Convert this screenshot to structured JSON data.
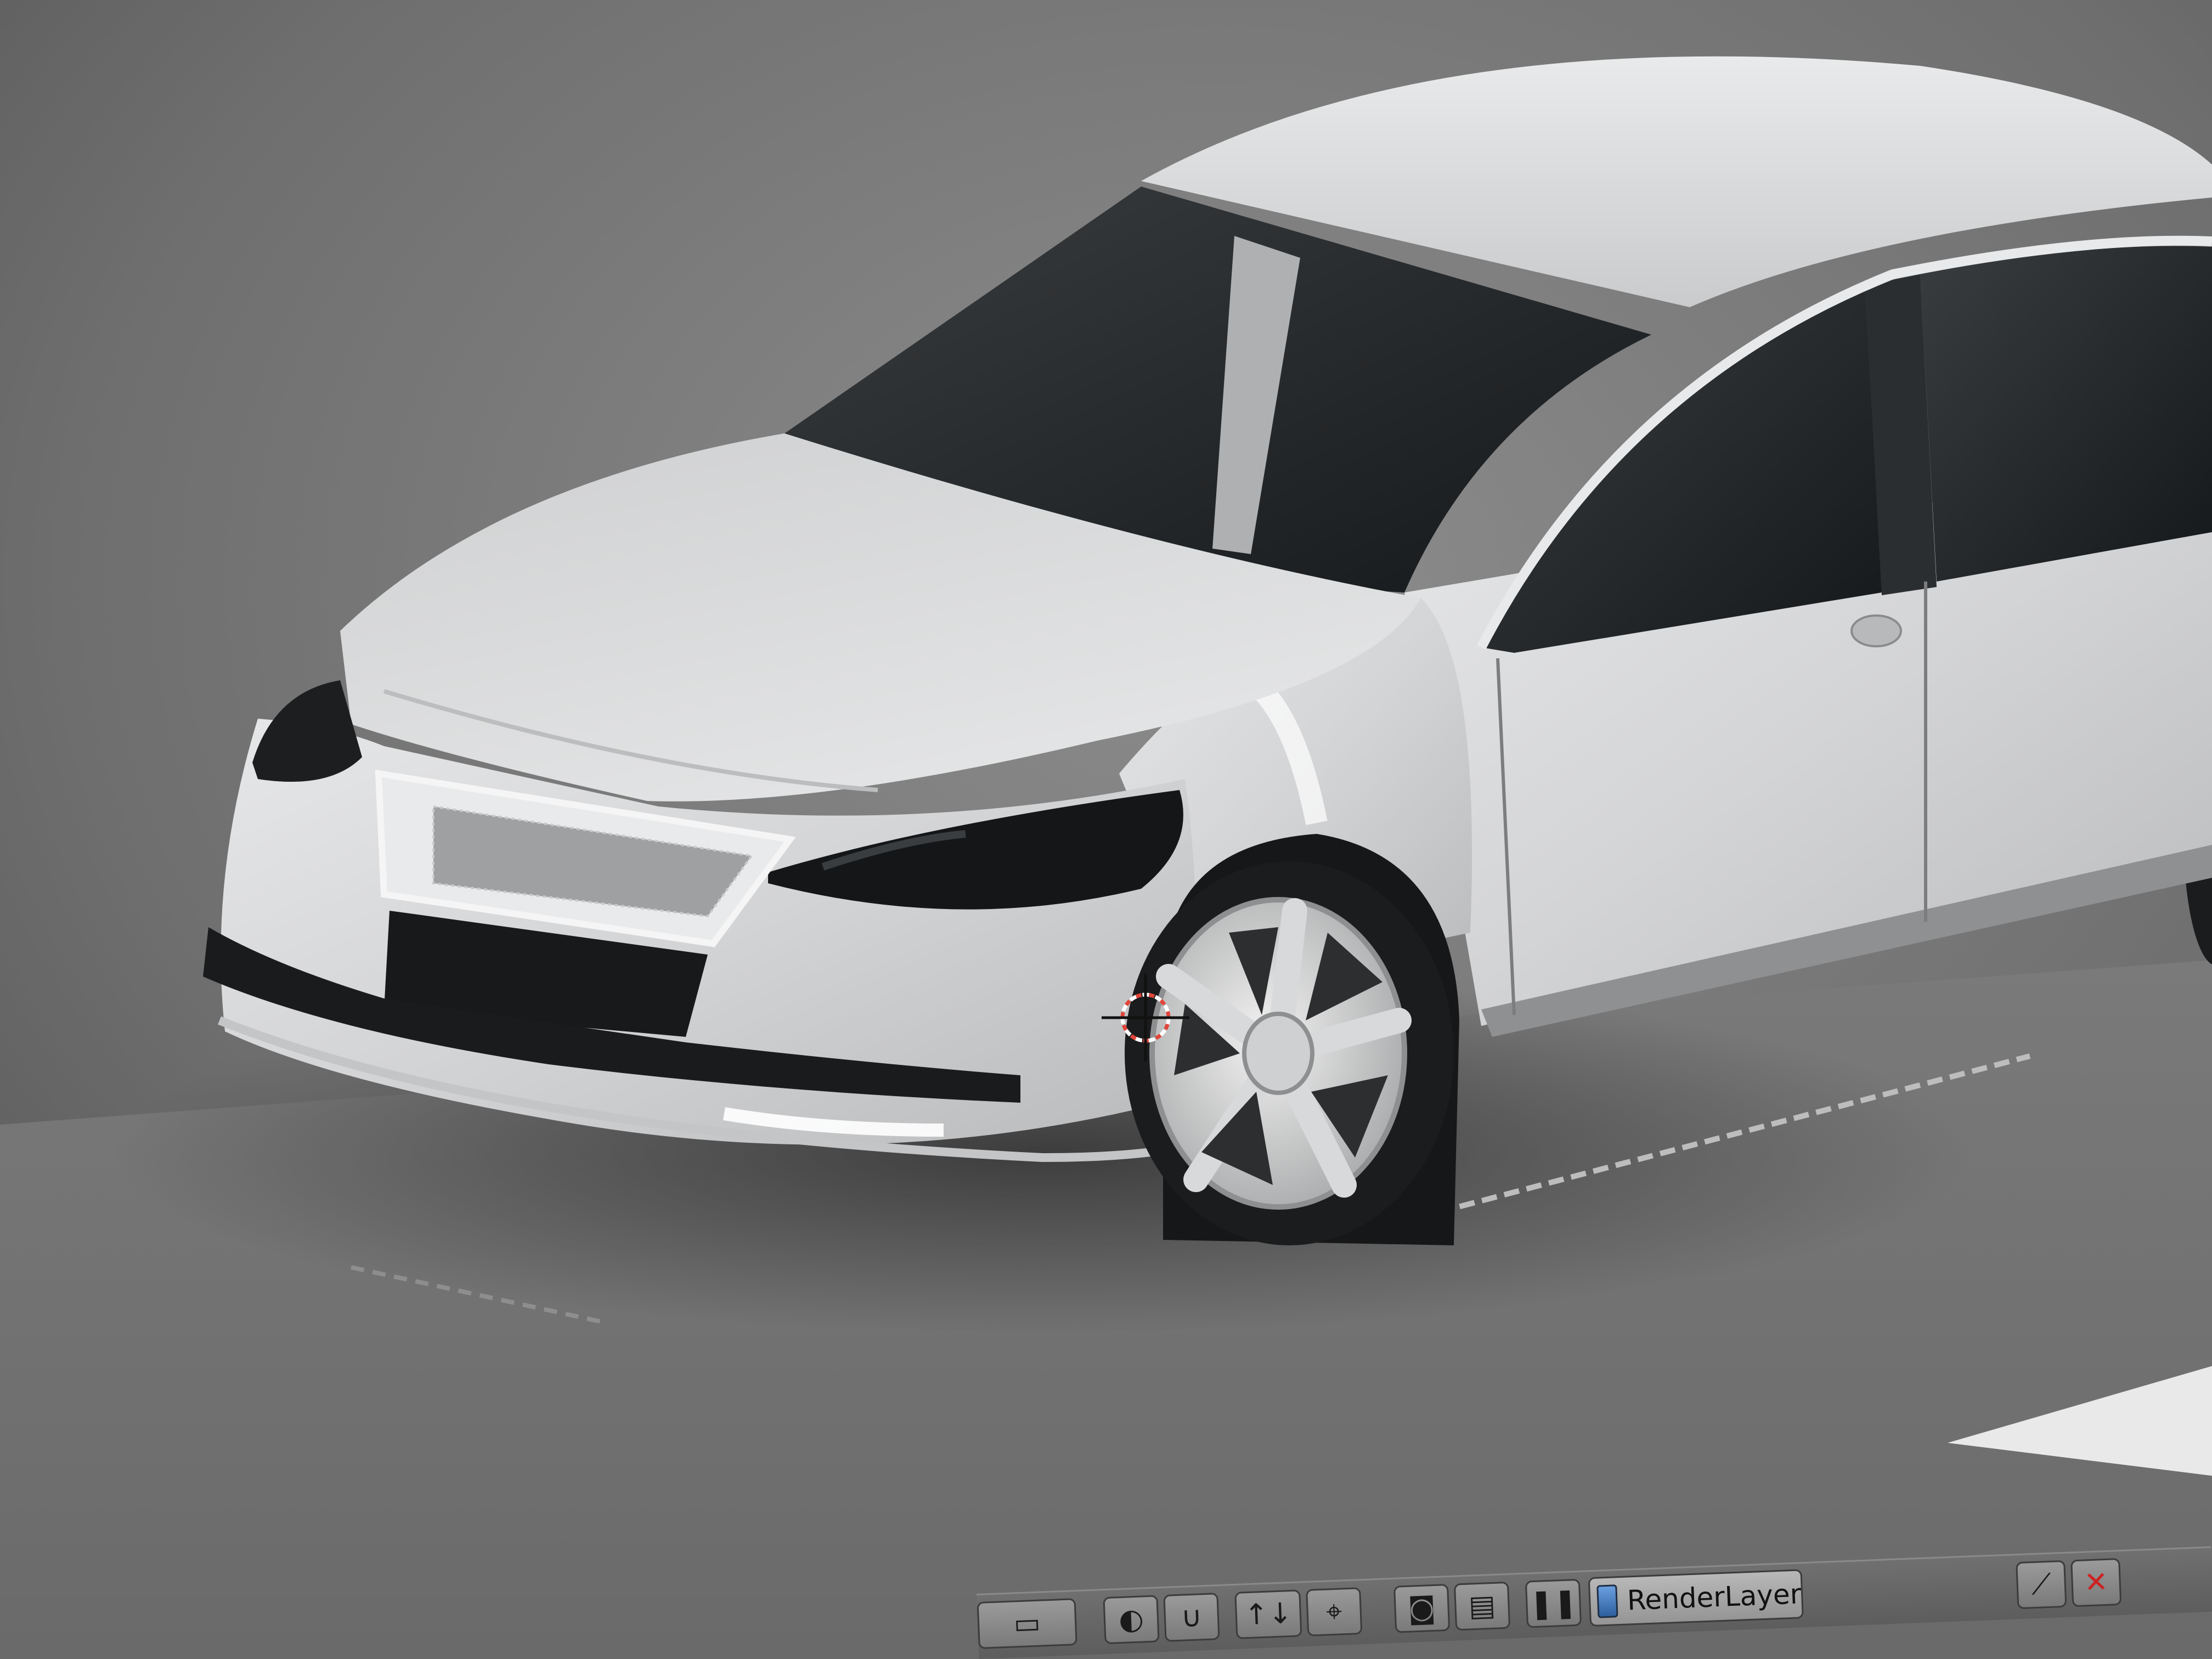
{
  "viewport": {
    "background_color": "#6e6e6e",
    "car_body_color": "#d8d9da",
    "glass_color": "#1f2224",
    "trim_color": "#161718",
    "wheel_color": "#cfd0d2",
    "cursor_color": "#e2453a"
  },
  "header": {
    "render_layer_label": "RenderLayer",
    "icons": [
      "mesh-select-icon",
      "sphere-shading-icon",
      "snap-magnet-icon",
      "manipulator-icon",
      "transform-orientation-icon",
      "camera-render-icon",
      "clapper-render-icon",
      "pause-icon",
      "render-layer-icon",
      "ruler-icon",
      "close-scissors-icon"
    ]
  }
}
